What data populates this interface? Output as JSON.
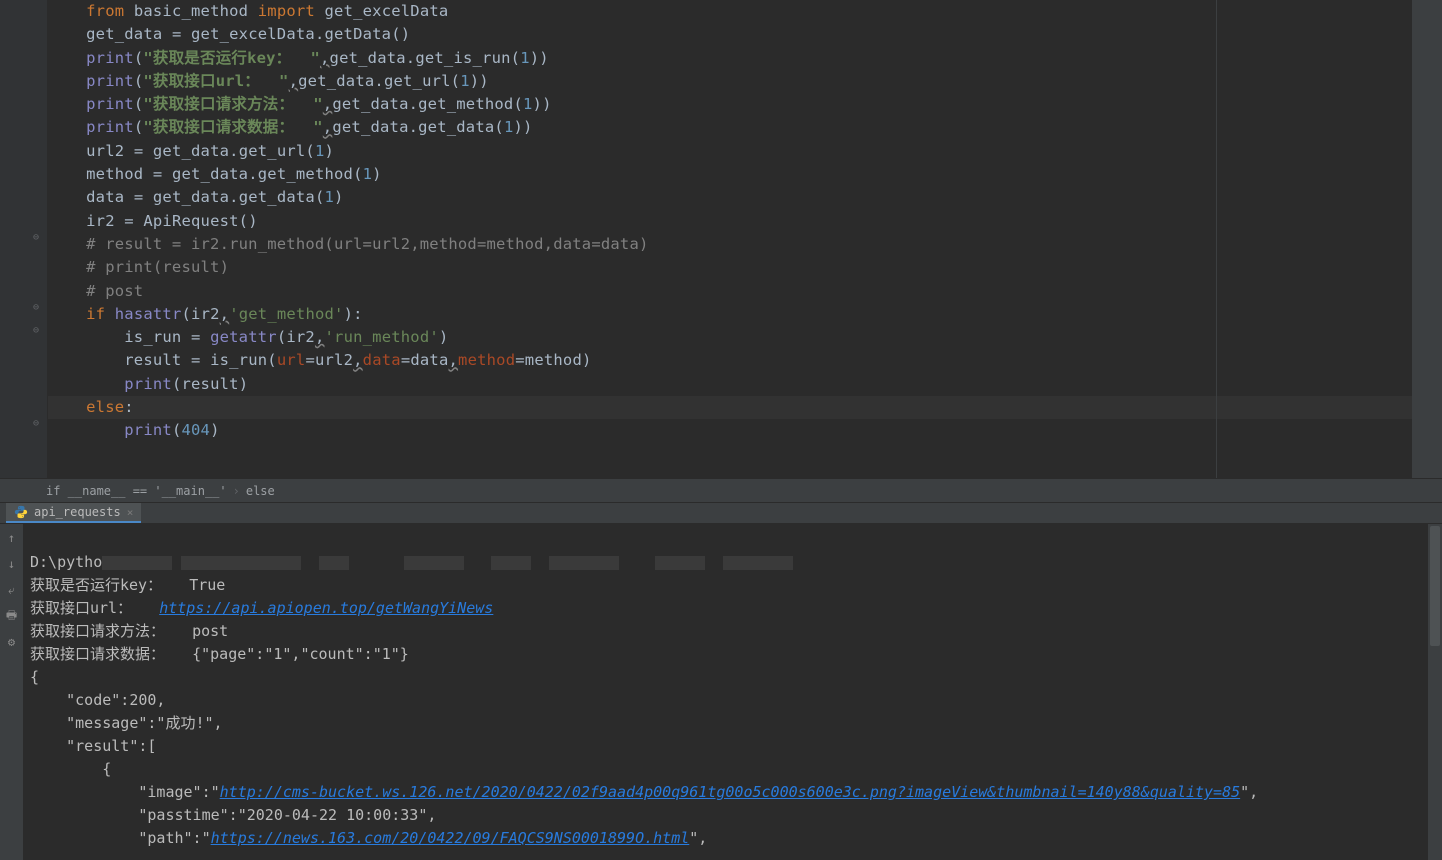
{
  "editor": {
    "right_margin_col": 120,
    "fold_markers": [
      10,
      13,
      14,
      18
    ]
  },
  "code": {
    "l1": {
      "kw1": "from",
      "mod": "basic_method",
      "kw2": "import",
      "name": "get_excelData"
    },
    "l2": {
      "lhs": "get_data",
      "rhs_obj": "get_excelData",
      "rhs_call": ".getData()"
    },
    "l3": {
      "fn": "print",
      "str": "\"获取是否运行key：  \"",
      "comma": ",",
      "obj": "get_data",
      "meth": ".get_is_run(",
      "arg": "1",
      "end": "))"
    },
    "l4": {
      "fn": "print",
      "str": "\"获取接口url：  \"",
      "comma": ",",
      "obj": "get_data",
      "meth": ".get_url(",
      "arg": "1",
      "end": "))"
    },
    "l5": {
      "fn": "print",
      "str": "\"获取接口请求方法：  \"",
      "comma": ",",
      "obj": "get_data",
      "meth": ".get_method(",
      "arg": "1",
      "end": "))"
    },
    "l6": {
      "fn": "print",
      "str": "\"获取接口请求数据：  \"",
      "comma": ",",
      "obj": "get_data",
      "meth": ".get_data(",
      "arg": "1",
      "end": "))"
    },
    "l7": {
      "lhs": "url2",
      "obj": "get_data",
      "meth": ".get_url(",
      "arg": "1",
      "end": ")"
    },
    "l8": {
      "lhs": "method",
      "obj": "get_data",
      "meth": ".get_method(",
      "arg": "1",
      "end": ")"
    },
    "l9": {
      "lhs": "data",
      "obj": "get_data",
      "meth": ".get_data(",
      "arg": "1",
      "end": ")"
    },
    "l10": {
      "lhs": "ir2",
      "rhs": "ApiRequest()"
    },
    "l11": {
      "text": "# result = ir2.run_method(url=url2,method=method,data=data)"
    },
    "l12": {
      "text": "# print(result)"
    },
    "l13": {
      "text": "# post"
    },
    "l14": {
      "kw": "if",
      "fn": "hasattr",
      "arg1": "ir2",
      "comma": ",",
      "str": "'get_method'",
      "end": "):"
    },
    "l15": {
      "lhs": "is_run",
      "fn": "getattr",
      "arg1": "ir2",
      "comma": ",",
      "str": "'run_method'",
      "end": ")"
    },
    "l16": {
      "lhs": "result",
      "fn": "is_run",
      "p1": "url",
      "v1": "url2",
      "p2": "data",
      "v2": "data",
      "p3": "method",
      "v3": "method"
    },
    "l17": {
      "fn": "print",
      "arg": "result"
    },
    "l18": {
      "kw": "else",
      "colon": ":"
    },
    "l19": {
      "fn": "print",
      "arg": "404"
    }
  },
  "breadcrumb": {
    "item1": "if __name__ == '__main__'",
    "item2": "else"
  },
  "tab": {
    "label": "api_requests"
  },
  "console": {
    "toolbar_icons": [
      "up-arrow",
      "down-arrow",
      "wrap",
      "print",
      "gear"
    ],
    "line1_prefix": "D:\\pytho",
    "line2_label": "获取是否运行key：   ",
    "line2_value": "True",
    "line3_label": "获取接口url：   ",
    "line3_link": "https://api.apiopen.top/getWangYiNews",
    "line4_label": "获取接口请求方法：   ",
    "line4_value": "post",
    "line5_label": "获取接口请求数据：   ",
    "line5_value": "{\"page\":\"1\",\"count\":\"1\"}",
    "json_open": "{",
    "json_code_key": "    \"code\":",
    "json_code_val": "200,",
    "json_message": "    \"message\":\"成功!\",",
    "json_result_open": "    \"result\":[",
    "json_obj_open": "        {",
    "json_image_key": "            \"image\":\"",
    "json_image_link": "http://cms-bucket.ws.126.net/2020/0422/02f9aad4p00q961tg00o5c000s600e3c.png?imageView&thumbnail=140y88&quality=85",
    "json_image_end": "\",",
    "json_passtime": "            \"passtime\":\"2020-04-22 10:00:33\",",
    "json_path_key": "            \"path\":\"",
    "json_path_link": "https://news.163.com/20/0422/09/FAQCS9NS0001899O.html",
    "json_path_end": "\","
  }
}
